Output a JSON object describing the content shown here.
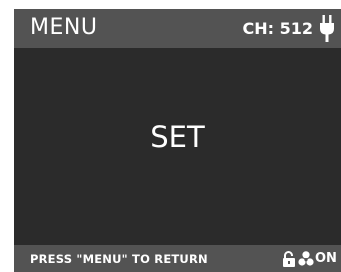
{
  "header": {
    "title": "MENU",
    "channel": "CH: 512",
    "power_icon": "plug-icon"
  },
  "main": {
    "label": "SET"
  },
  "footer": {
    "hint": "PRESS \"MENU\" TO RETURN",
    "lock_icon": "lock-icon",
    "fan_icon": "fan-icon",
    "fan_status": "ON"
  },
  "colors": {
    "screen_background": "#2b2b2b",
    "bar_background": "#535353",
    "text": "#ffffff"
  }
}
